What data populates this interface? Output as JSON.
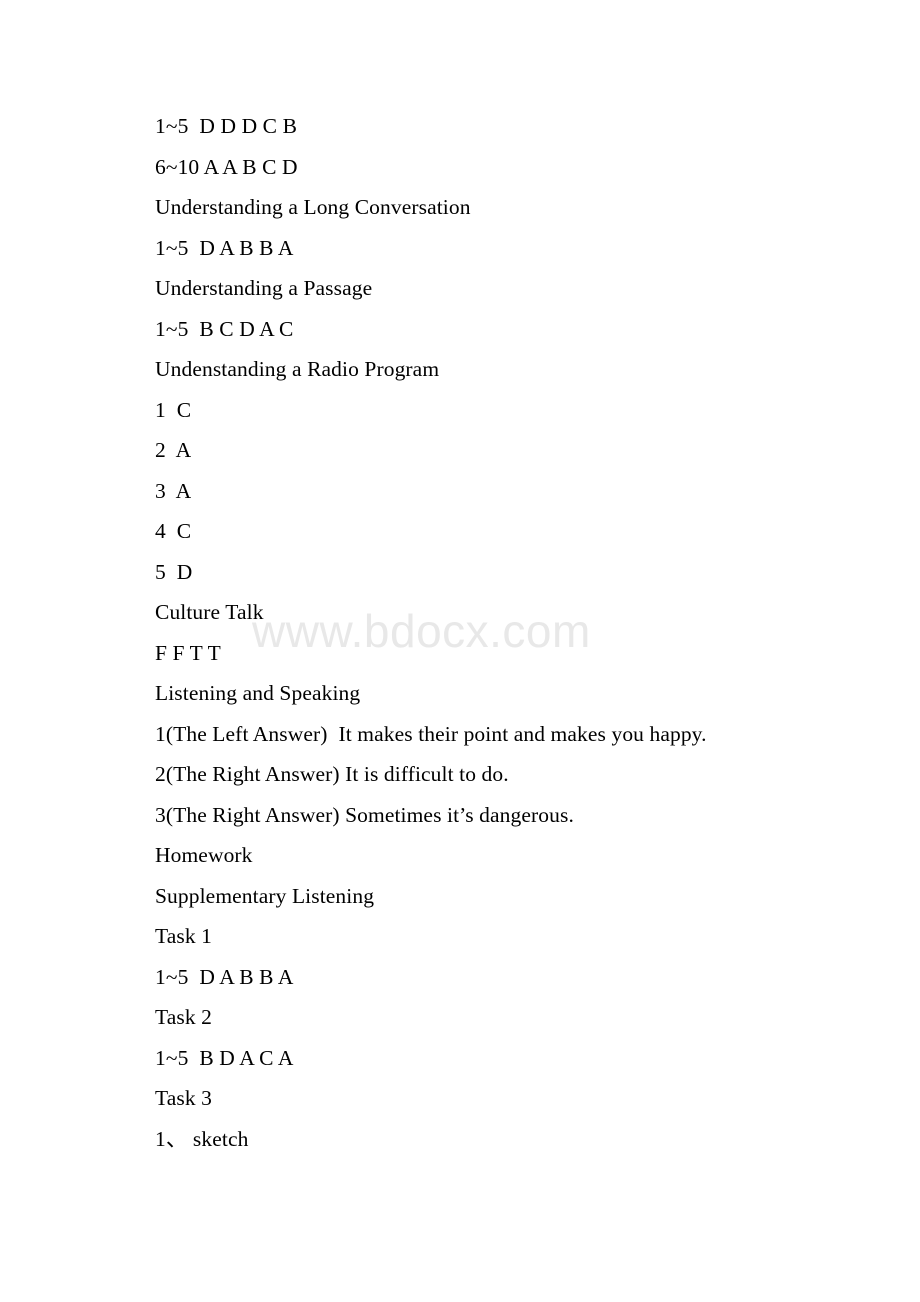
{
  "document": {
    "background_color": "#ffffff",
    "text_color": "#000000",
    "watermark": {
      "text": "www.bdocx.com",
      "color": "#e8e8e8"
    },
    "lines": [
      {
        "id": "l1",
        "kind": "answers",
        "text": "1~5  D D D C B"
      },
      {
        "id": "l2",
        "kind": "answers",
        "text": "6~10 A A B C D"
      },
      {
        "id": "l3",
        "kind": "heading",
        "text": "Understanding a Long Conversation"
      },
      {
        "id": "l4",
        "kind": "answers",
        "text": "1~5  D A B B A"
      },
      {
        "id": "l5",
        "kind": "heading",
        "text": "Understanding a Passage"
      },
      {
        "id": "l6",
        "kind": "answers",
        "text": "1~5  B C D A C"
      },
      {
        "id": "l7",
        "kind": "heading",
        "text": "Undenstanding a Radio Program"
      },
      {
        "id": "l8",
        "kind": "answers",
        "text": "1  C"
      },
      {
        "id": "l9",
        "kind": "answers",
        "text": "2  A"
      },
      {
        "id": "l10",
        "kind": "answers",
        "text": "3  A"
      },
      {
        "id": "l11",
        "kind": "answers",
        "text": "4  C"
      },
      {
        "id": "l12",
        "kind": "answers",
        "text": "5  D"
      },
      {
        "id": "l13",
        "kind": "heading",
        "text": "Culture Talk"
      },
      {
        "id": "l14",
        "kind": "answers",
        "text": "F F T T"
      },
      {
        "id": "l15",
        "kind": "heading",
        "text": "Listening and Speaking"
      },
      {
        "id": "l16",
        "kind": "answers",
        "text": "1(The Left Answer)  It makes their point and makes you happy."
      },
      {
        "id": "l17",
        "kind": "answers",
        "text": "2(The Right Answer) It is difficult to do."
      },
      {
        "id": "l18",
        "kind": "answers",
        "text": "3(The Right Answer) Sometimes it’s dangerous."
      },
      {
        "id": "l19",
        "kind": "heading",
        "text": "Homework"
      },
      {
        "id": "l20",
        "kind": "heading",
        "text": "Supplementary Listening"
      },
      {
        "id": "l21",
        "kind": "heading",
        "text": "Task 1"
      },
      {
        "id": "l22",
        "kind": "answers",
        "text": "1~5  D A B B A"
      },
      {
        "id": "l23",
        "kind": "heading",
        "text": "Task 2"
      },
      {
        "id": "l24",
        "kind": "answers",
        "text": "1~5  B D A C A"
      },
      {
        "id": "l25",
        "kind": "heading",
        "text": "Task 3"
      },
      {
        "id": "l26",
        "kind": "answers",
        "text": "1、 sketch"
      }
    ]
  }
}
